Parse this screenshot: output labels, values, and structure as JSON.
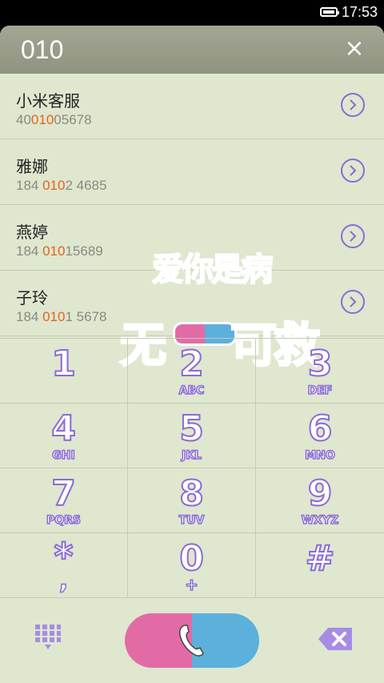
{
  "status": {
    "time": "17:53"
  },
  "header": {
    "query": "010",
    "close_label": "×"
  },
  "results": [
    {
      "name": "小米客服",
      "num_pre": "40",
      "num_hl": "010",
      "num_post": "05678"
    },
    {
      "name": "雅娜",
      "num_pre": "184 ",
      "num_hl": "010",
      "num_post": "2 4685"
    },
    {
      "name": "燕婷",
      "num_pre": "184 ",
      "num_hl": "010",
      "num_post": "15689"
    },
    {
      "name": "子玲",
      "num_pre": "184 ",
      "num_hl": "010",
      "num_post": "1 5678"
    }
  ],
  "overlay": {
    "line1": "爱你是病",
    "line2_a": "无",
    "line2_b": "可救"
  },
  "keys": [
    {
      "digit": "1",
      "letters": ""
    },
    {
      "digit": "2",
      "letters": "ABC"
    },
    {
      "digit": "3",
      "letters": "DEF"
    },
    {
      "digit": "4",
      "letters": "GHI"
    },
    {
      "digit": "5",
      "letters": "JKL"
    },
    {
      "digit": "6",
      "letters": "MNO"
    },
    {
      "digit": "7",
      "letters": "PQRS"
    },
    {
      "digit": "8",
      "letters": "TUV"
    },
    {
      "digit": "9",
      "letters": "WXYZ"
    },
    {
      "digit": "*",
      "letters": ","
    },
    {
      "digit": "0",
      "letters": "+"
    },
    {
      "digit": "#",
      "letters": ""
    }
  ],
  "icons": {
    "battery": "battery-icon",
    "close": "close-icon",
    "arrow": "chevron-right-icon",
    "dialpad": "dialpad-grid-icon",
    "call": "phone-icon",
    "backspace": "backspace-icon"
  },
  "colors": {
    "accent_purple": "#8b6ad6",
    "highlight_orange": "#e4621f",
    "pink": "#e26ba6",
    "blue": "#5bb0dc",
    "background": "#dfe7cf"
  }
}
